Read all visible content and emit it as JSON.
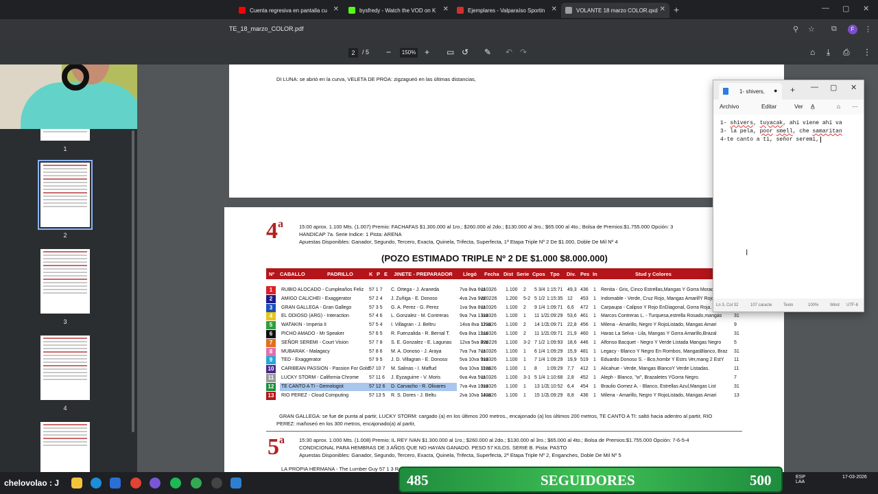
{
  "browser": {
    "tabs": [
      {
        "label": "Cuenta regresiva en pantalla cu",
        "icon": "youtube-icon",
        "color": "#ff0000"
      },
      {
        "label": "bysfredy - Watch the VOD on K",
        "icon": "kick-icon",
        "color": "#53fc18"
      },
      {
        "label": "Ejemplares - Valparaíso Sportin",
        "icon": "sporting-icon",
        "color": "#d32f2f"
      },
      {
        "label": "VOLANTE 18 marzo COLOR.qxd",
        "icon": "pdf-icon",
        "color": "#9aa0a6"
      }
    ],
    "url": "TE_18_marzo_COLOR.pdf",
    "profile_letter": "F"
  },
  "pdf_toolbar": {
    "page_current": "2",
    "page_total": "/ 5",
    "zoom": "150%"
  },
  "sidebar": {
    "page_numbers": [
      "1",
      "2",
      "3",
      "4"
    ]
  },
  "page1": {
    "note": "DI LUNA: se abrió en la curva,      VELETA DE PROA: zigzagueó en las últimas distancias,"
  },
  "race4": {
    "number": "4",
    "sup": "a",
    "line1": "15:00 aprox. 1.100 Mts. (1.007)   Premio: FACHAFAS   $1.300.000 al 1ro.; $260.000 al 2do.; $130.000 al 3ro.; $65.000 al 4to.;        Bolsa de Premios:$1.755.000     Opción: 3",
    "line2": "HANDICAP  7a. Serie  Indice: 1 Pista: ARENA",
    "line3": "Apuestas Disponibles: Ganador, Segundo, Tercero, Exacta, Quinela, Trifecta, Superfecta, 1ª Etapa Triple Nº 2 De $1.000, Doble De Mil Nº 4",
    "pozo": "(POZO ESTIMADO TRIPLE Nº 2 DE $1.000  $8.000.000)",
    "headers": [
      "Nº",
      "CABALLO",
      "PADRILLO",
      "K",
      "P",
      "E",
      "JINETE - PREPARADOR",
      "Llegó",
      "Fecha",
      "Dist",
      "Serie",
      "Cpos",
      "Tpo",
      "Div.",
      "Pes",
      "In",
      "Stud y Colores"
    ],
    "rows": [
      {
        "n": "1",
        "color": "#d8232a",
        "caballo": "RUBIO ALOCADO - Cumpleaños Feliz",
        "kpe": "57  1   7",
        "jinete": "C. Ortega - J. Araneda",
        "llego": "7va 8va 6va",
        "fecha": "110326",
        "dist": "1.100",
        "serie": "2",
        "cpos": "5 3/4",
        "tpo": "1:15:71",
        "div": "49,3",
        "pes": "436",
        "in": "1",
        "stud": "Renita - Gris, Cinco Estrellas,Mangas Y Gorra Morado.",
        "end": ""
      },
      {
        "n": "2",
        "color": "#1d1d8c",
        "caballo": "AMIGO CALICHEI - Exaggerator",
        "kpe": "57  2   4",
        "jinete": "J. Zuñiga - E. Donoso",
        "llego": "4va 2va 9va",
        "fecha": "220226",
        "dist": "1.200",
        "serie": "5-2",
        "cpos": "5 1/2",
        "tpo": "1:15:35",
        "div": "12",
        "pes": "453",
        "in": "1",
        "stud": "Indomable - Verde, Cruz Rojo, Mangas AmarillY Rojo Li",
        "end": ""
      },
      {
        "n": "3",
        "color": "#1d4fb8",
        "caballo": "GRAN GALLEGA - Gran Gallego",
        "kpe": "57  3   5",
        "jinete": "G. A. Perez - G. Perez",
        "llego": "1va 9va 8va",
        "fecha": "110326",
        "dist": "1.100",
        "serie": "2",
        "cpos": "9 1/4",
        "tpo": "1:09:71",
        "div": "6,6",
        "pes": "472",
        "in": "1",
        "stud": "Carpaupa - Calipso Y Rojo EnDiagonal, Gorra Roja.",
        "end": ""
      },
      {
        "n": "4",
        "color": "#e6c619",
        "caballo": "EL ODIOSO (ARG) - Interaction",
        "kpe": "57  4   6",
        "jinete": "L. Gonzalez - M. Contreras",
        "llego": "9va 7va 13va",
        "fecha": "110326",
        "dist": "1.100",
        "serie": "1",
        "cpos": "11 1/2",
        "tpo": "1:09:29",
        "div": "53,6",
        "pes": "461",
        "in": "1",
        "stud": "Marcos Contreras L. - Turquesa,estrella Rosado,mangas",
        "end": "31"
      },
      {
        "n": "5",
        "color": "#2e9e3e",
        "caballo": "WATAKIN - Imperia II",
        "kpe": "57  5   4",
        "jinete": "I. Villagran - J. Beltru",
        "llego": "14va 8va 12va",
        "fecha": "110326",
        "dist": "1.100",
        "serie": "2",
        "cpos": "14 1/2",
        "tpo": "1:09:71",
        "div": "22,8",
        "pes": "456",
        "in": "1",
        "stud": "Milena - Amarillo, Negro Y RojoListado, Mangas Amari",
        "end": "9"
      },
      {
        "n": "6",
        "color": "#111111",
        "caballo": "PICHO AMADO - Mr Speaker",
        "kpe": "57  6   5",
        "jinete": "R. Fuenzalida - R. Bernal T.",
        "llego": "6va 8va 11va",
        "fecha": "110326",
        "dist": "1.100",
        "serie": "2",
        "cpos": "11 1/2",
        "tpo": "1:09:71",
        "div": "21,9",
        "pes": "460",
        "in": "1",
        "stud": "Haras La Selva - Lila, Mangas Y Gorra Amarillo,Brazal",
        "end": "31"
      },
      {
        "n": "7",
        "color": "#e0711d",
        "caballo": "SEÑOR SEREMI - Court Vision",
        "kpe": "57  7   8",
        "jinete": "S. E. Gonzalez - E. Lagunas",
        "llego": "12va 5va 8va",
        "fecha": "220226",
        "dist": "1.100",
        "serie": "3-2",
        "cpos": "7 1/2",
        "tpo": "1:09:93",
        "div": "18,6",
        "pes": "446",
        "in": "1",
        "stud": "Alfonso Bacquet - Negro Y Verde Listada Mangas Negro",
        "end": "5"
      },
      {
        "n": "8",
        "color": "#e36fae",
        "caballo": "MUBARAK - Malagacy",
        "kpe": "57  8   6",
        "jinete": "M. A. Donoso - J. Araya",
        "llego": "7va 7va 7va",
        "fecha": "110326",
        "dist": "1.100",
        "serie": "1",
        "cpos": "6 1/4",
        "tpo": "1:09:29",
        "div": "15,9",
        "pes": "481",
        "in": "1",
        "stud": "Legacy - Blanco Y Negro En Rombos, MangasBlanco, Braz",
        "end": "31"
      },
      {
        "n": "9",
        "color": "#2aa7d6",
        "caballo": "TED - Exaggerator",
        "kpe": "57  9   5",
        "jinete": "J. D. Villagran - E. Donoso",
        "llego": "5va 10va 9va",
        "fecha": "110326",
        "dist": "1.100",
        "serie": "1",
        "cpos": "7 1/4",
        "tpo": "1:09:29",
        "div": "19,9",
        "pes": "519",
        "in": "1",
        "stud": "Eduardo Donoso S. - Bco,hombr Y Estrs Ver,mang 2 EstY",
        "end": "11"
      },
      {
        "n": "10",
        "color": "#4a2a8c",
        "caballo": "CARIBEAN PASSION - Passion For Gold",
        "kpe": "57  10  7",
        "jinete": "M. Salinas - I. Maffud",
        "llego": "6va 10va 11va",
        "fecha": "110326",
        "dist": "1.100",
        "serie": "1",
        "cpos": "8",
        "tpo": "1:09:29",
        "div": "7,7",
        "pes": "412",
        "in": "1",
        "stud": "Alicahue - Verde, Mangas BlancoY Verde Listadas.",
        "end": "11"
      },
      {
        "n": "11",
        "color": "#9a9a9a",
        "caballo": "LUCKY STORM - California Chrome",
        "kpe": "57  11  6",
        "jinete": "J. Eyzaguirre - V. Moris",
        "llego": "6va 4va 5va",
        "fecha": "110326",
        "dist": "1.100",
        "serie": "3-1",
        "cpos": "5 1/4",
        "tpo": "1:10:68",
        "div": "2,8",
        "pes": "452",
        "in": "1",
        "stud": "Aleph - Blanco, \"w\", Brazaletes YGorra Negro.",
        "end": "7"
      },
      {
        "n": "12",
        "color": "#1f8c3e",
        "caballo": "TE CANTO A TI - Gemologist",
        "kpe": "57  12  6",
        "jinete": "D. Carvacho - R. Olivares",
        "llego": "7va 4va 10va",
        "fecha": "110326",
        "dist": "1.100",
        "serie": "1",
        "cpos": "13 1/2",
        "tpo": "1:10:52",
        "div": "6,4",
        "pes": "454",
        "in": "1",
        "stud": "Braulio Gomez A. - Blanco, Estrellas Azul,Mangas List",
        "end": "31"
      },
      {
        "n": "13",
        "color": "#b3151a",
        "caballo": "RIO PEREZ - Cloud Computing",
        "kpe": "57  13  5",
        "jinete": "R. S. Dores - J. Beltu",
        "llego": "2va 10va 14va",
        "fecha": "110326",
        "dist": "1.100",
        "serie": "1",
        "cpos": "15 1/2",
        "tpo": "1:09:29",
        "div": "8,8",
        "pes": "436",
        "in": "1",
        "stud": "Milena - Amarillo, Negro Y RojoListado, Mangas Amari",
        "end": "13"
      }
    ],
    "notes1": "GRAN GALLEGA: se fue de punta al partir,      LUCKY STORM: cargado (a) en los últimos  200 metros., encajonado (a) los últimos  200 metros,  TE CANTO A TI: saltó hacia adentro al partir,  RIO",
    "notes2": "PEREZ: mañoseó en los 300 metros, encajonado(a) al partir,"
  },
  "race5": {
    "number": "5",
    "sup": "a",
    "line1": "15:30 aprox. 1.000 Mts. (1.008)   Premio: IL REY IVAN   $1.300.000 al 1ro.; $260.000 al 2do.; $130.000 al 3ro.; $65.000 al 4to.;      Bolsa de Premios:$1.755.000     Opción: 7-6-5-4",
    "line2": "CONDICIONAL  PARA HEMBRAS DE 3 AÑOS QUE NO HAYAN GANADO. PESO 57 KILOS. SERIE B.  Pista: PASTO",
    "line3": "Apuestas Disponibles: Ganador, Segundo, Tercero, Exacta, Quinela, Trifecta, Superfecta, 2ª Etapa Triple Nº 2, Enganches, Doble De Mil Nº 5",
    "first_row": "LA PROPIA HERMANA - The Lumber Guy    57  1   3  R. S. D"
  },
  "notepad": {
    "tab_title": "1- shivers,",
    "tab_dot": "●",
    "menu": [
      "Archivo",
      "Editar",
      "Ver"
    ],
    "lines": [
      [
        "1- ",
        "shivers",
        ", ",
        "tuyacak",
        ", ahí viene ahí va"
      ],
      [
        "3- la pela, ",
        "poor",
        " ",
        "smell",
        ", che ",
        "samaritan",
        ""
      ],
      [
        "4-te canto a ti, señor seremi, ",
        "",
        "",
        "",
        ""
      ]
    ],
    "status": {
      "pos": "Ln 3, Col 32",
      "chars": "107 caracte",
      "text": "Texto",
      "zoom": "100%",
      "eol": "Wind",
      "enc": "UTF-8"
    }
  },
  "taskbar": {
    "channel": "chelovolao : J"
  },
  "followers": {
    "current": "485",
    "label": "SEGUIDORES",
    "goal": "500"
  },
  "tray": {
    "lang": "ESP",
    "region": "LAA",
    "date": "17-03-2026"
  }
}
